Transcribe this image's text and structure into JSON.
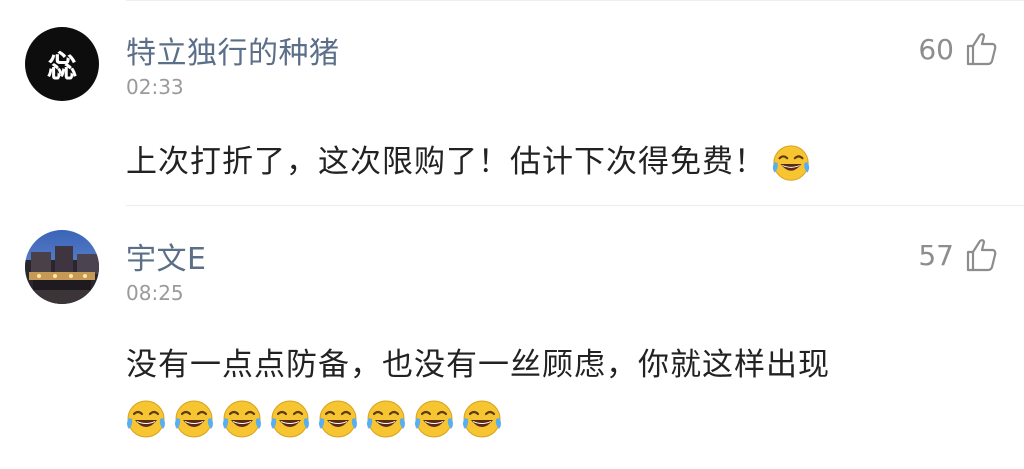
{
  "comments": [
    {
      "username": "特立独行的种猪",
      "time": "02:33",
      "likes": "60",
      "avatar_text": "惢",
      "text": "上次打折了，这次限购了！估计下次得免费！",
      "emoji": "laughing-tears-emoji"
    },
    {
      "username": "宇文E",
      "time": "08:25",
      "likes": "57",
      "avatar_scene": "night-street-photo",
      "text": "没有一点点防备，也没有一丝顾虑，你就这样出现",
      "emoji_count": 8,
      "emoji": "laughing-tears-emoji"
    }
  ],
  "icons": {
    "like": "thumbs-up-icon"
  },
  "colors": {
    "username": "#5b6f88",
    "time": "#9a9a9a",
    "text": "#222222",
    "like": "#8d8d8d"
  }
}
